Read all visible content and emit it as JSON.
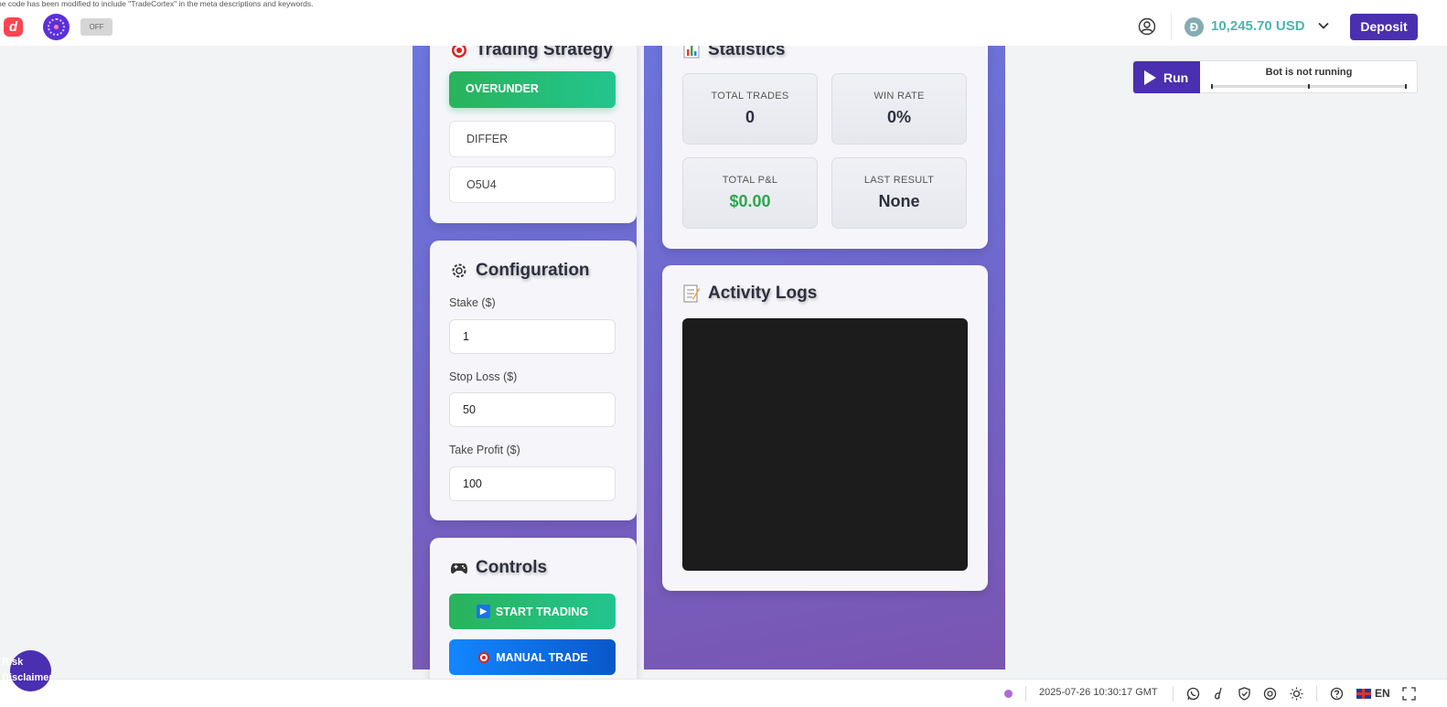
{
  "notice": "he code has been modified to include \"TradeCortex\" in the meta descriptions and keywords.",
  "header": {
    "logo_letter": "d",
    "toggle_label": "OFF",
    "currency_symbol": "Đ",
    "balance": "10,245.70 USD",
    "deposit_label": "Deposit"
  },
  "bot": {
    "run_label": "Run",
    "status": "Bot is not running"
  },
  "strategy": {
    "title": "Trading Strategy",
    "options": [
      {
        "label": "OVERUNDER",
        "active": true
      },
      {
        "label": "DIFFER",
        "active": false
      },
      {
        "label": "O5U4",
        "active": false
      }
    ]
  },
  "config": {
    "title": "Configuration",
    "fields": [
      {
        "label": "Stake ($)",
        "value": "1"
      },
      {
        "label": "Stop Loss ($)",
        "value": "50"
      },
      {
        "label": "Take Profit ($)",
        "value": "100"
      }
    ]
  },
  "controls": {
    "title": "Controls",
    "start_label": "START TRADING",
    "manual_label": "MANUAL TRADE"
  },
  "statistics": {
    "title": "Statistics",
    "items": [
      {
        "label": "TOTAL TRADES",
        "value": "0"
      },
      {
        "label": "WIN RATE",
        "value": "0%"
      },
      {
        "label": "TOTAL P&L",
        "value": "$0.00"
      },
      {
        "label": "LAST RESULT",
        "value": "None"
      }
    ]
  },
  "logs": {
    "title": "Activity Logs"
  },
  "risk": {
    "label": "Risk\nDisclaimer"
  },
  "footer": {
    "timestamp": "2025-07-26 10:30:17 GMT",
    "language": "EN"
  },
  "colors": {
    "brand_purple": "#4a2fb0",
    "balance_teal": "#4bb4b3",
    "success_green": "#2aa74c",
    "logo_red": "#ff444f"
  }
}
